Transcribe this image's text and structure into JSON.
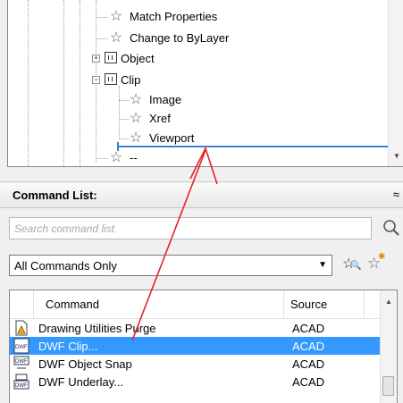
{
  "tree": {
    "items": [
      {
        "label": "Match Properties"
      },
      {
        "label": "Change to ByLayer"
      },
      {
        "label": "Object"
      },
      {
        "label": "Clip"
      },
      {
        "label": "Image"
      },
      {
        "label": "Xref"
      },
      {
        "label": "Viewport"
      },
      {
        "label": "--"
      }
    ]
  },
  "command_list": {
    "title": "Command List:",
    "search_placeholder": "Search command list",
    "filter_value": "All Commands Only",
    "columns": [
      "Command",
      "Source"
    ],
    "rows": [
      {
        "command": "Drawing Utilities Purge",
        "source": "ACAD",
        "selected": false
      },
      {
        "command": "DWF Clip...",
        "source": "ACAD",
        "selected": true
      },
      {
        "command": "DWF Object Snap",
        "source": "ACAD",
        "selected": false
      },
      {
        "command": "DWF Underlay...",
        "source": "ACAD",
        "selected": false
      }
    ]
  },
  "colors": {
    "selection": "#3399ff",
    "drop_indicator": "#3d7fd6",
    "annotation_arrow": "#e8202a"
  }
}
